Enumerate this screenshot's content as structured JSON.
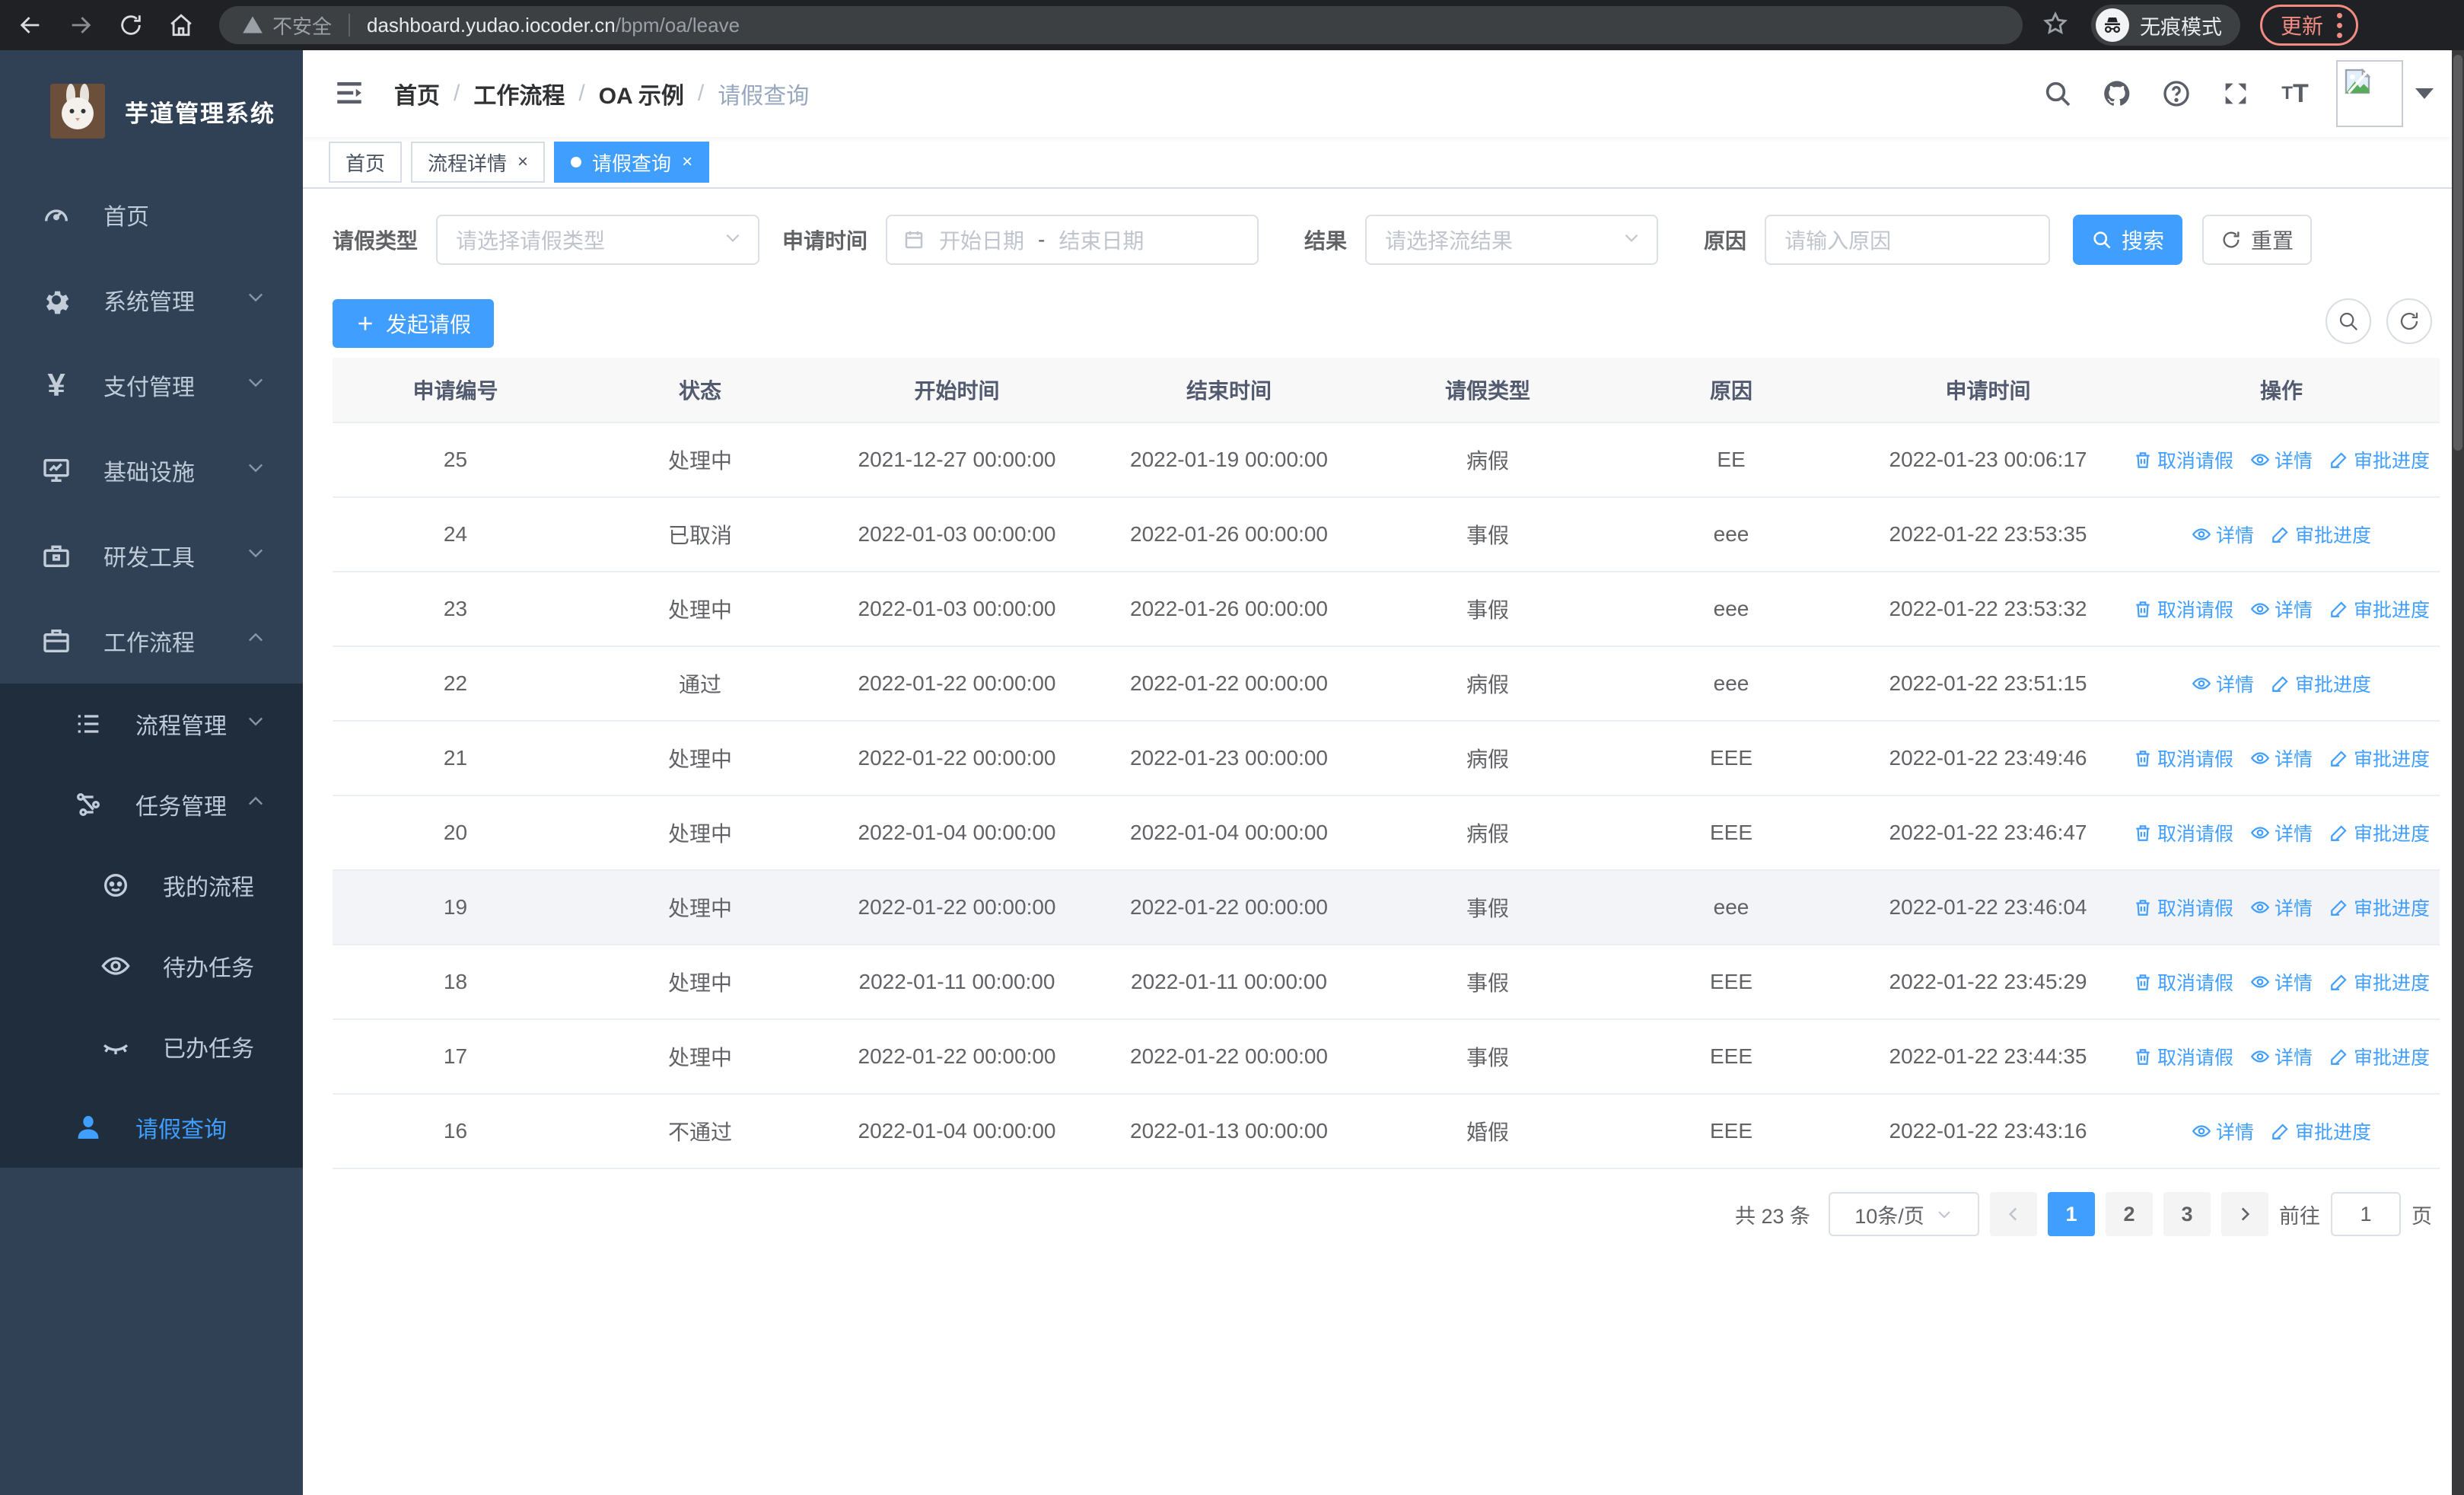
{
  "browser": {
    "security_warning": "不安全",
    "url_host": "dashboard.yudao.iocoder.cn",
    "url_path": "/bpm/oa/leave",
    "incognito_label": "无痕模式",
    "update_label": "更新"
  },
  "sidebar": {
    "app_title": "芋道管理系统",
    "items": [
      {
        "label": "首页"
      },
      {
        "label": "系统管理"
      },
      {
        "label": "支付管理"
      },
      {
        "label": "基础设施"
      },
      {
        "label": "研发工具"
      },
      {
        "label": "工作流程"
      }
    ],
    "submenu": [
      {
        "label": "流程管理"
      },
      {
        "label": "任务管理"
      },
      {
        "label": "我的流程"
      },
      {
        "label": "待办任务"
      },
      {
        "label": "已办任务"
      },
      {
        "label": "请假查询"
      }
    ]
  },
  "header": {
    "breadcrumb": [
      "首页",
      "工作流程",
      "OA 示例",
      "请假查询"
    ],
    "breadcrumb_separator": "/"
  },
  "tabs": [
    {
      "label": "首页"
    },
    {
      "label": "流程详情"
    },
    {
      "label": "请假查询"
    }
  ],
  "filters": {
    "leave_type_label": "请假类型",
    "leave_type_placeholder": "请选择请假类型",
    "apply_time_label": "申请时间",
    "start_date_placeholder": "开始日期",
    "date_separator": "-",
    "end_date_placeholder": "结束日期",
    "result_label": "结果",
    "result_placeholder": "请选择流结果",
    "reason_label": "原因",
    "reason_placeholder": "请输入原因",
    "search_label": "搜索",
    "reset_label": "重置"
  },
  "toolbar": {
    "create_label": "发起请假"
  },
  "table": {
    "columns": [
      "申请编号",
      "状态",
      "开始时间",
      "结束时间",
      "请假类型",
      "原因",
      "申请时间",
      "操作"
    ],
    "action_cancel": "取消请假",
    "action_detail": "详情",
    "action_progress": "审批进度",
    "rows": [
      {
        "id": "25",
        "status": "处理中",
        "start": "2021-12-27 00:00:00",
        "end": "2022-01-19 00:00:00",
        "type": "病假",
        "reason": "EE",
        "applied": "2022-01-23 00:06:17",
        "can_cancel": true,
        "highlight": false
      },
      {
        "id": "24",
        "status": "已取消",
        "start": "2022-01-03 00:00:00",
        "end": "2022-01-26 00:00:00",
        "type": "事假",
        "reason": "eee",
        "applied": "2022-01-22 23:53:35",
        "can_cancel": false,
        "highlight": false
      },
      {
        "id": "23",
        "status": "处理中",
        "start": "2022-01-03 00:00:00",
        "end": "2022-01-26 00:00:00",
        "type": "事假",
        "reason": "eee",
        "applied": "2022-01-22 23:53:32",
        "can_cancel": true,
        "highlight": false
      },
      {
        "id": "22",
        "status": "通过",
        "start": "2022-01-22 00:00:00",
        "end": "2022-01-22 00:00:00",
        "type": "病假",
        "reason": "eee",
        "applied": "2022-01-22 23:51:15",
        "can_cancel": false,
        "highlight": false
      },
      {
        "id": "21",
        "status": "处理中",
        "start": "2022-01-22 00:00:00",
        "end": "2022-01-23 00:00:00",
        "type": "病假",
        "reason": "EEE",
        "applied": "2022-01-22 23:49:46",
        "can_cancel": true,
        "highlight": false
      },
      {
        "id": "20",
        "status": "处理中",
        "start": "2022-01-04 00:00:00",
        "end": "2022-01-04 00:00:00",
        "type": "病假",
        "reason": "EEE",
        "applied": "2022-01-22 23:46:47",
        "can_cancel": true,
        "highlight": false
      },
      {
        "id": "19",
        "status": "处理中",
        "start": "2022-01-22 00:00:00",
        "end": "2022-01-22 00:00:00",
        "type": "事假",
        "reason": "eee",
        "applied": "2022-01-22 23:46:04",
        "can_cancel": true,
        "highlight": true
      },
      {
        "id": "18",
        "status": "处理中",
        "start": "2022-01-11 00:00:00",
        "end": "2022-01-11 00:00:00",
        "type": "事假",
        "reason": "EEE",
        "applied": "2022-01-22 23:45:29",
        "can_cancel": true,
        "highlight": false
      },
      {
        "id": "17",
        "status": "处理中",
        "start": "2022-01-22 00:00:00",
        "end": "2022-01-22 00:00:00",
        "type": "事假",
        "reason": "EEE",
        "applied": "2022-01-22 23:44:35",
        "can_cancel": true,
        "highlight": false
      },
      {
        "id": "16",
        "status": "不通过",
        "start": "2022-01-04 00:00:00",
        "end": "2022-01-13 00:00:00",
        "type": "婚假",
        "reason": "EEE",
        "applied": "2022-01-22 23:43:16",
        "can_cancel": false,
        "highlight": false
      }
    ]
  },
  "pagination": {
    "total": "共 23 条",
    "page_size": "10条/页",
    "pages": [
      "1",
      "2",
      "3"
    ],
    "active_page": "1",
    "goto_label": "前往",
    "goto_value": "1",
    "unit_label": "页"
  },
  "colors": {
    "accent": "#409eff",
    "sidebar_bg": "#304156",
    "submenu_bg": "#1f2d3d"
  }
}
